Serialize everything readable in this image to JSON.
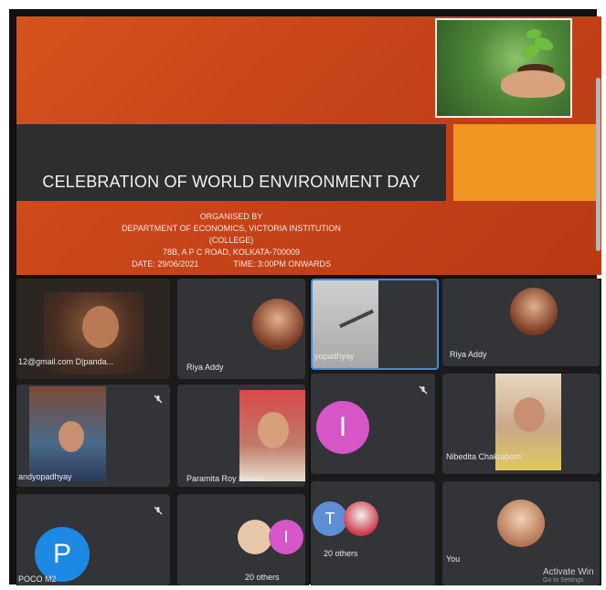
{
  "banner": {
    "title": "CELEBRATION OF WORLD ENVIRONMENT DAY",
    "organised_by": "ORGANISED BY",
    "department": "DEPARTMENT OF ECONOMICS, VICTORIA INSTITUTION (COLLEGE)",
    "address": "78B, A P C ROAD, KOLKATA-700009",
    "date": "DATE: 29/06/2021",
    "time": "TIME: 3:00PM ONWARDS"
  },
  "left_panel": {
    "tiles": [
      {
        "name": "12@gmail.com D|panda...",
        "type": "video"
      },
      {
        "name": "Riya Addy",
        "type": "video"
      },
      {
        "name": "andyopadhyay",
        "type": "video"
      },
      {
        "name": "Paramita Roy Biswas",
        "type": "video"
      },
      {
        "name": "POCO M2",
        "type": "avatar",
        "initial": "P",
        "color": "#1e88e5"
      },
      {
        "name": "20 others",
        "type": "group",
        "initial": "I",
        "color": "#d656c8"
      }
    ]
  },
  "right_panel": {
    "tiles": [
      {
        "name": "yopadhyay",
        "type": "video"
      },
      {
        "name": "Riya Addy",
        "type": "video"
      },
      {
        "name": "",
        "type": "avatar",
        "initial": "I",
        "color": "#d656c8"
      },
      {
        "name": "Nibedita Chakraborti",
        "type": "video"
      },
      {
        "name": "20 others",
        "type": "group",
        "initial": "T",
        "color": "#5c8fd6"
      },
      {
        "name": "You",
        "type": "video"
      }
    ],
    "watermark_title": "Activate Win",
    "watermark_sub": "Go to Settings"
  }
}
